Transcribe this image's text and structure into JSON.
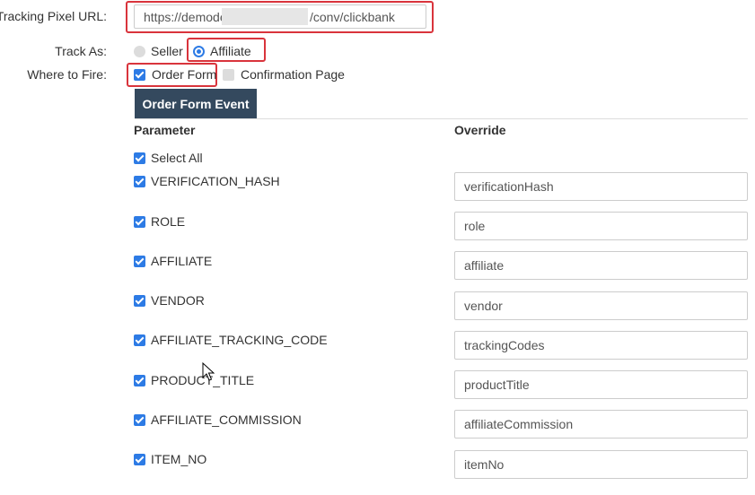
{
  "tracking_pixel": {
    "label": "Tracking Pixel URL:",
    "url_prefix": "https://demode",
    "url_suffix": "/conv/clickbank"
  },
  "track_as": {
    "label": "Track As:",
    "options": [
      {
        "label": "Seller",
        "selected": false
      },
      {
        "label": "Affiliate",
        "selected": true
      }
    ]
  },
  "where_to_fire": {
    "label": "Where to Fire:",
    "options": [
      {
        "label": "Order Form",
        "checked": true
      },
      {
        "label": "Confirmation Page",
        "checked": false
      }
    ]
  },
  "tab": {
    "label": "Order Form Event"
  },
  "table": {
    "headers": {
      "parameter": "Parameter",
      "override": "Override"
    },
    "select_all": {
      "label": "Select All",
      "checked": true
    },
    "rows": [
      {
        "parameter": "VERIFICATION_HASH",
        "override": "verificationHash",
        "checked": true
      },
      {
        "parameter": "ROLE",
        "override": "role",
        "checked": true
      },
      {
        "parameter": "AFFILIATE",
        "override": "affiliate",
        "checked": true
      },
      {
        "parameter": "VENDOR",
        "override": "vendor",
        "checked": true
      },
      {
        "parameter": "AFFILIATE_TRACKING_CODE",
        "override": "trackingCodes",
        "checked": true
      },
      {
        "parameter": "PRODUCT_TITLE",
        "override": "productTitle",
        "checked": true
      },
      {
        "parameter": "AFFILIATE_COMMISSION",
        "override": "affiliateCommission",
        "checked": true
      },
      {
        "parameter": "ITEM_NO",
        "override": "itemNo",
        "checked": true
      }
    ]
  },
  "colors": {
    "accent": "#2d7be5",
    "highlight": "#d9343c",
    "tab_bg": "#34495e"
  }
}
